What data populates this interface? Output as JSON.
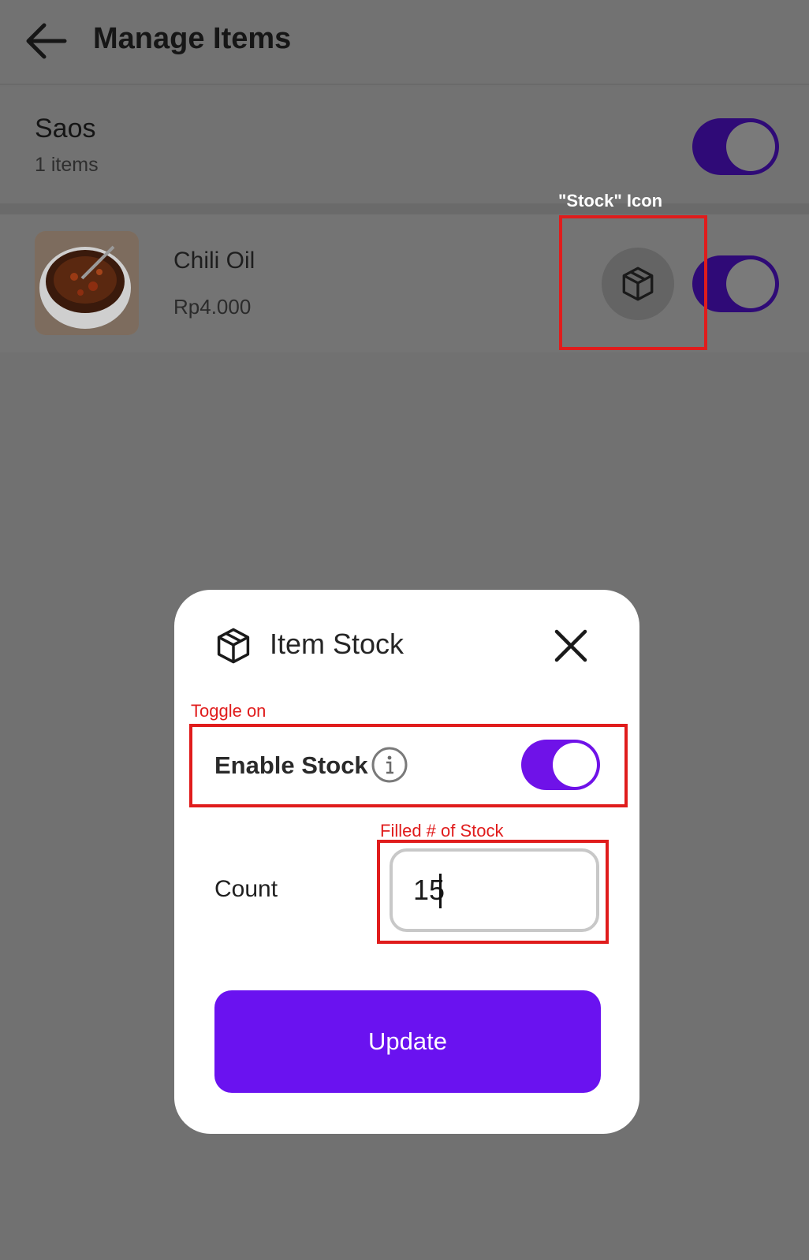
{
  "header": {
    "title": "Manage Items"
  },
  "category": {
    "name": "Saos",
    "count": "1 items",
    "enabled": true
  },
  "item": {
    "name": "Chili Oil",
    "price": "Rp4.000",
    "enabled": true
  },
  "dialog": {
    "title": "Item Stock",
    "enable_label": "Enable Stock",
    "enable_stock": true,
    "count_label": "Count",
    "count_value": "15",
    "update_label": "Update"
  },
  "annotations": {
    "stock_icon": "\"Stock\" Icon",
    "toggle_on": "Toggle on",
    "filled_stock": "Filled # of Stock"
  },
  "colors": {
    "accent": "#6a12f0",
    "overlay": "#717171",
    "annotation": "#e01c1c"
  },
  "icons": [
    "back-arrow-icon",
    "box-icon",
    "close-icon",
    "info-icon"
  ]
}
